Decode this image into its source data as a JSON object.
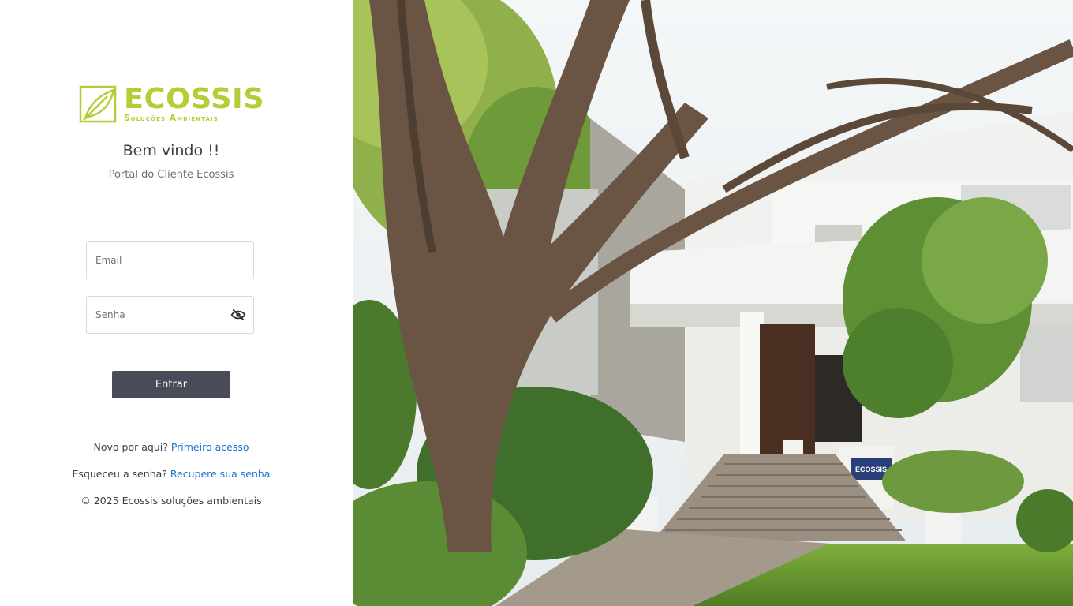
{
  "brand": {
    "name": "ECOSSIS",
    "tagline": "Soluções Ambientais",
    "color": "#b5cc34"
  },
  "header": {
    "welcome": "Bem vindo !!",
    "subtitle": "Portal do Cliente Ecossis"
  },
  "form": {
    "email_placeholder": "Email",
    "email_value": "",
    "password_placeholder": "Senha",
    "password_value": "",
    "toggle_icon": "eye-slash-icon",
    "submit_label": "Entrar",
    "submit_color": "#474c58"
  },
  "links": {
    "new_text": "Novo por aqui?",
    "new_link": "Primeiro acesso",
    "forgot_text": "Esqueceu a senha?",
    "forgot_link": "Recupere sua senha",
    "link_color": "#1a73d6"
  },
  "footer": {
    "copyright": "© 2025 Ecossis soluções ambientais"
  },
  "photo": {
    "sign_text": "ECOSSIS"
  }
}
